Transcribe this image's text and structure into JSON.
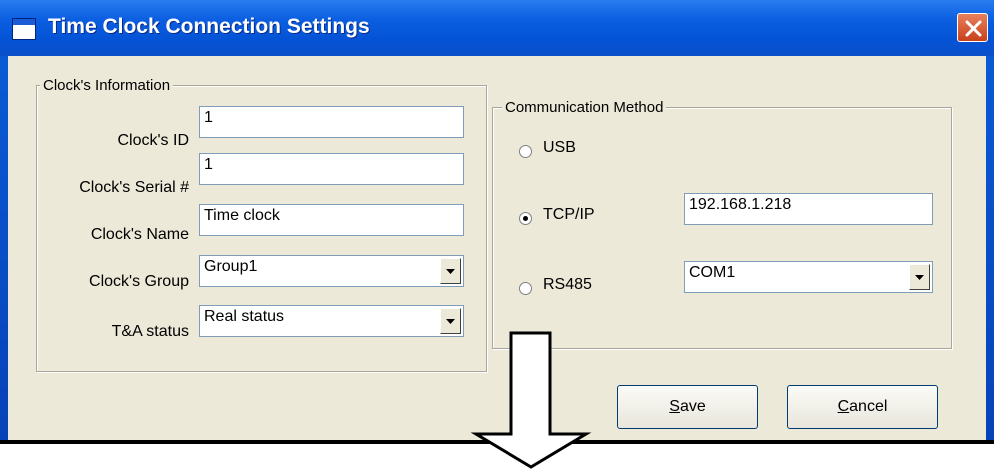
{
  "window": {
    "title": "Time Clock Connection Settings"
  },
  "clock_info": {
    "group_label": "Clock's Information",
    "id_label": "Clock's ID",
    "id_value": "1",
    "serial_label": "Clock's Serial #",
    "serial_value": "1",
    "name_label": "Clock's Name",
    "name_value": "Time clock",
    "group_field_label": "Clock's Group",
    "group_value": "Group1",
    "status_label": "T&A status",
    "status_value": "Real status"
  },
  "communication": {
    "group_label": "Communication Method",
    "selected": "TCP/IP",
    "usb_label": "USB",
    "tcpip_label": "TCP/IP",
    "tcpip_address": "192.168.1.218",
    "rs485_label": "RS485",
    "rs485_port": "COM1"
  },
  "buttons": {
    "save_mnemonic": "S",
    "save_rest": "ave",
    "cancel_mnemonic": "C",
    "cancel_rest": "ancel"
  },
  "icons": {
    "close": "close-icon",
    "dropdown": "chevron-down-icon",
    "window": "window-icon",
    "annotation": "arrow-down-icon"
  },
  "colors": {
    "titlebar": "#0453d6",
    "dialog_face": "#ece9d8",
    "close_button": "#c8411c",
    "input_border": "#7f9db9"
  }
}
